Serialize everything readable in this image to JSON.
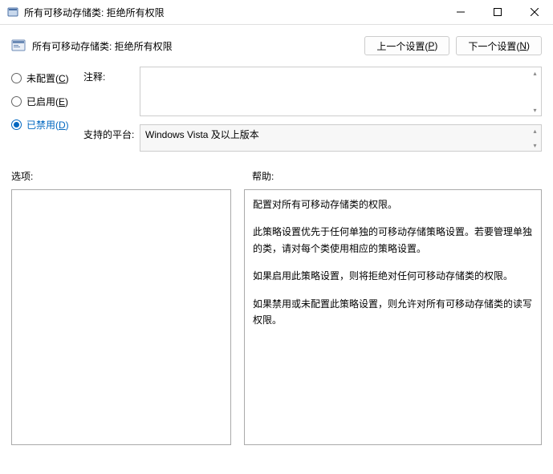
{
  "titlebar": {
    "title": "所有可移动存储类: 拒绝所有权限"
  },
  "header": {
    "title": "所有可移动存储类: 拒绝所有权限",
    "prev_label": "上一个设置(",
    "prev_key": "P",
    "next_label": "下一个设置(",
    "next_key": "N",
    "close_paren": ")"
  },
  "radios": {
    "not_configured": {
      "label": "未配置(",
      "key": "C",
      "close": ")"
    },
    "enabled": {
      "label": "已启用(",
      "key": "E",
      "close": ")"
    },
    "disabled": {
      "label": "已禁用(",
      "key": "D",
      "close": ")"
    }
  },
  "fields": {
    "comment_label": "注释:",
    "platform_label": "支持的平台:",
    "platform_value": "Windows Vista 及以上版本"
  },
  "section_labels": {
    "options": "选项:",
    "help": "帮助:"
  },
  "help": {
    "p1": "配置对所有可移动存储类的权限。",
    "p2": "此策略设置优先于任何单独的可移动存储策略设置。若要管理单独的类，请对每个类使用相应的策略设置。",
    "p3": "如果启用此策略设置，则将拒绝对任何可移动存储类的权限。",
    "p4": "如果禁用或未配置此策略设置，则允许对所有可移动存储类的读写权限。"
  }
}
